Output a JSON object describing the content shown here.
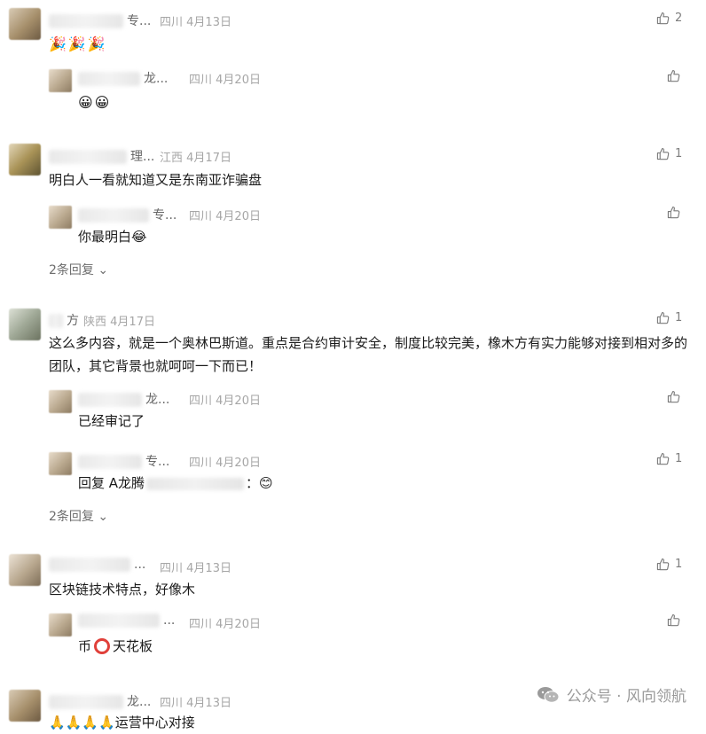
{
  "comments": [
    {
      "name_suffix": "专...",
      "location": "四川",
      "date": "4月13日",
      "likes": "2",
      "text": "🎉🎉🎉",
      "replies": [
        {
          "name_suffix": "龙...",
          "location": "四川",
          "date": "4月20日",
          "likes": "",
          "text": "😀😀"
        }
      ]
    },
    {
      "name_suffix": "理...",
      "location": "江西",
      "date": "4月17日",
      "likes": "1",
      "text": "明白人一看就知道又是东南亚诈骗盘",
      "replies": [
        {
          "name_suffix": "专...",
          "location": "四川",
          "date": "4月20日",
          "likes": "",
          "text": "你最明白😂"
        }
      ],
      "more_label": "2条回复"
    },
    {
      "name_suffix": "方",
      "location": "陕西",
      "date": "4月17日",
      "likes": "1",
      "text": "这么多内容，就是一个奥林巴斯道。重点是合约审计安全，制度比较完美，橡木方有实力能够对接到相对多的团队，其它背景也就呵呵一下而已！",
      "replies": [
        {
          "name_suffix": "龙...",
          "location": "四川",
          "date": "4月20日",
          "likes": "",
          "text": "已经审记了"
        },
        {
          "name_suffix": "专...",
          "location": "四川",
          "date": "4月20日",
          "likes": "1",
          "text_prefix": "回复 A龙腾",
          "text_suffix": "：😊"
        }
      ],
      "more_label": "2条回复"
    },
    {
      "name_suffix": "...",
      "location": "四川",
      "date": "4月13日",
      "likes": "1",
      "text": "区块链技术特点，好像木",
      "replies": [
        {
          "name_suffix": "...",
          "location": "四川",
          "date": "4月20日",
          "likes": "",
          "text_prefix": "币",
          "text_suffix": "天花板"
        }
      ]
    },
    {
      "name_suffix": "龙...",
      "location": "四川",
      "date": "4月13日",
      "likes": "",
      "text": "🙏🙏🙏🙏运营中心对接"
    }
  ],
  "watermark": {
    "icon": "wechat-icon",
    "text": "公众号 · 风向领航"
  },
  "icons": {
    "like": "thumbs-up-icon",
    "chevron": "chevron-down-icon"
  }
}
